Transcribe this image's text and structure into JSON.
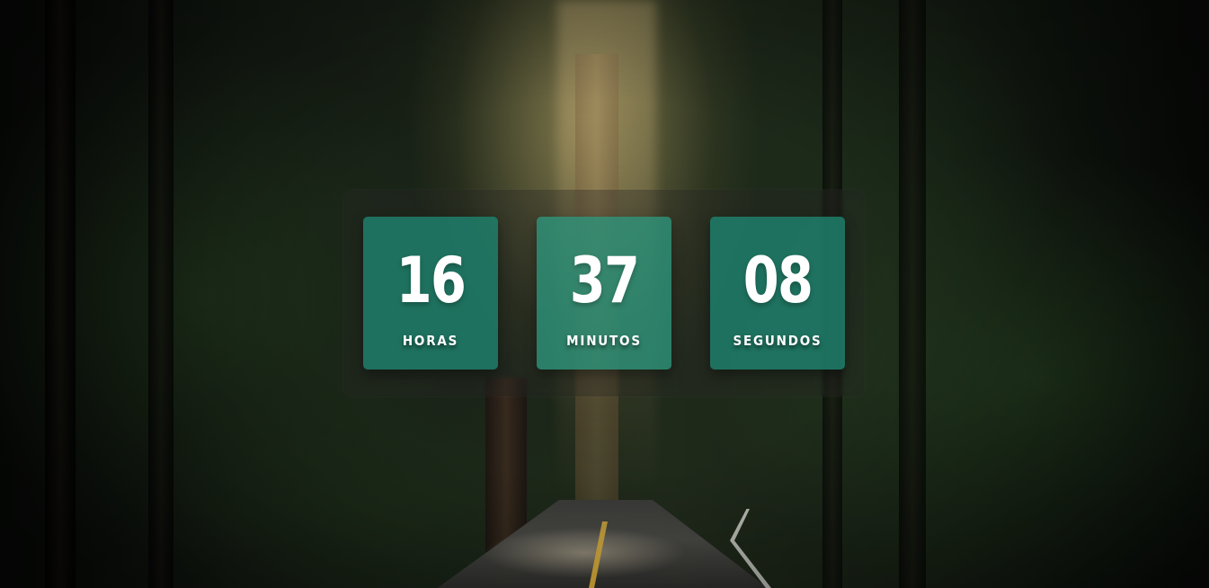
{
  "countdown": {
    "hours": {
      "value": "16",
      "label": "HORAS"
    },
    "minutes": {
      "value": "37",
      "label": "MINUTOS"
    },
    "seconds": {
      "value": "08",
      "label": "SEGUNDOS"
    }
  },
  "colors": {
    "card": "#1e826e",
    "panel": "#282824",
    "text": "#ffffff"
  }
}
